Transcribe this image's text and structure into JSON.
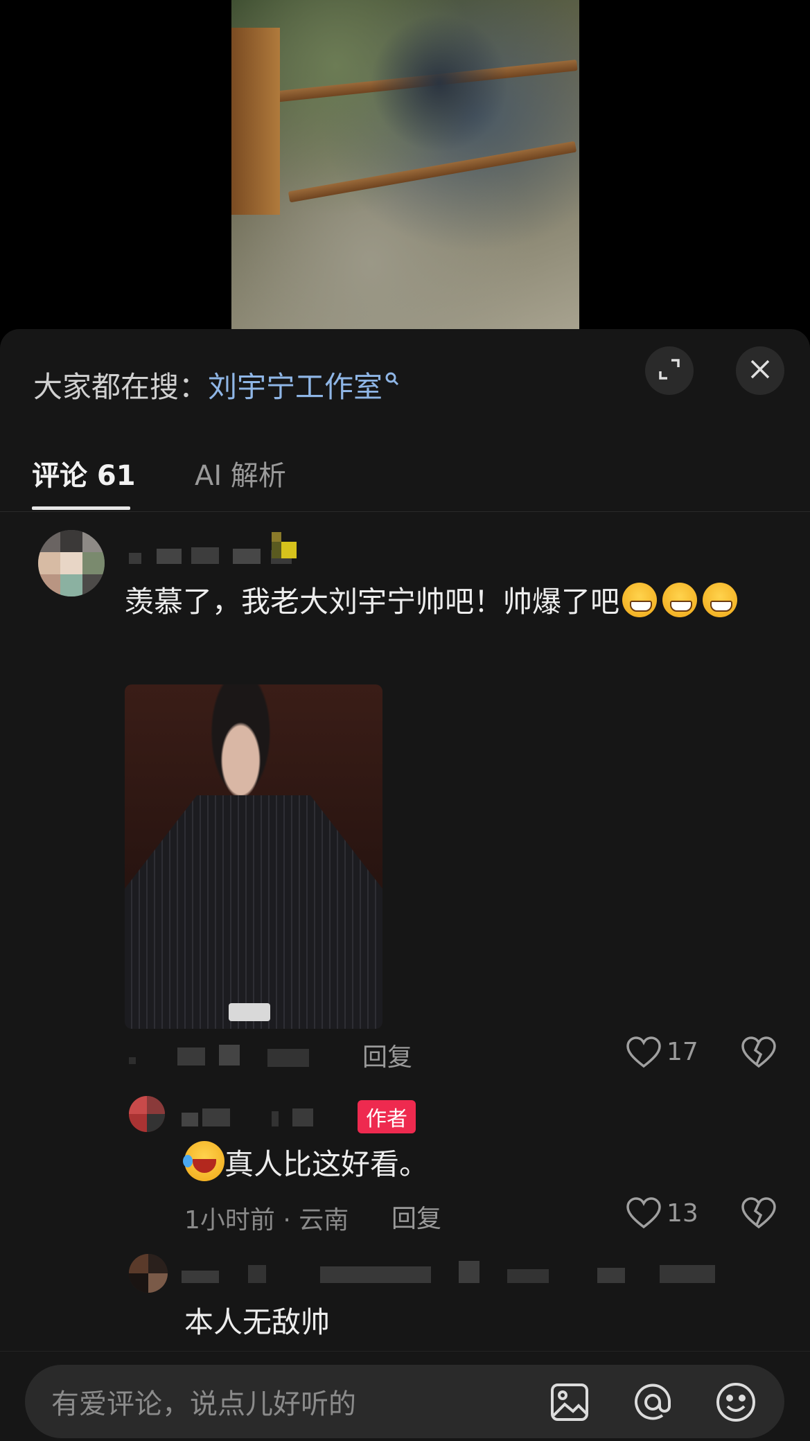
{
  "video": {},
  "search": {
    "prefix": "大家都在搜：",
    "term": "刘宇宁工作室"
  },
  "tabs": [
    {
      "label": "评论 61",
      "active": true
    },
    {
      "label": "AI 解析",
      "active": false
    }
  ],
  "comments": [
    {
      "text": "羡慕了，我老大刘宇宁帅吧！帅爆了吧",
      "reply_label": "回复",
      "likes": "17"
    },
    {
      "badge": "作者",
      "text": "真人比这好看。",
      "meta": "1小时前 · 云南",
      "reply_label": "回复",
      "likes": "13"
    },
    {
      "text": "本人无敌帅"
    }
  ],
  "input": {
    "placeholder": "有爱评论，说点儿好听的"
  },
  "colors": {
    "sheet": "#161616",
    "link": "#8fb6e6",
    "author_badge": "#ee2a4f"
  }
}
